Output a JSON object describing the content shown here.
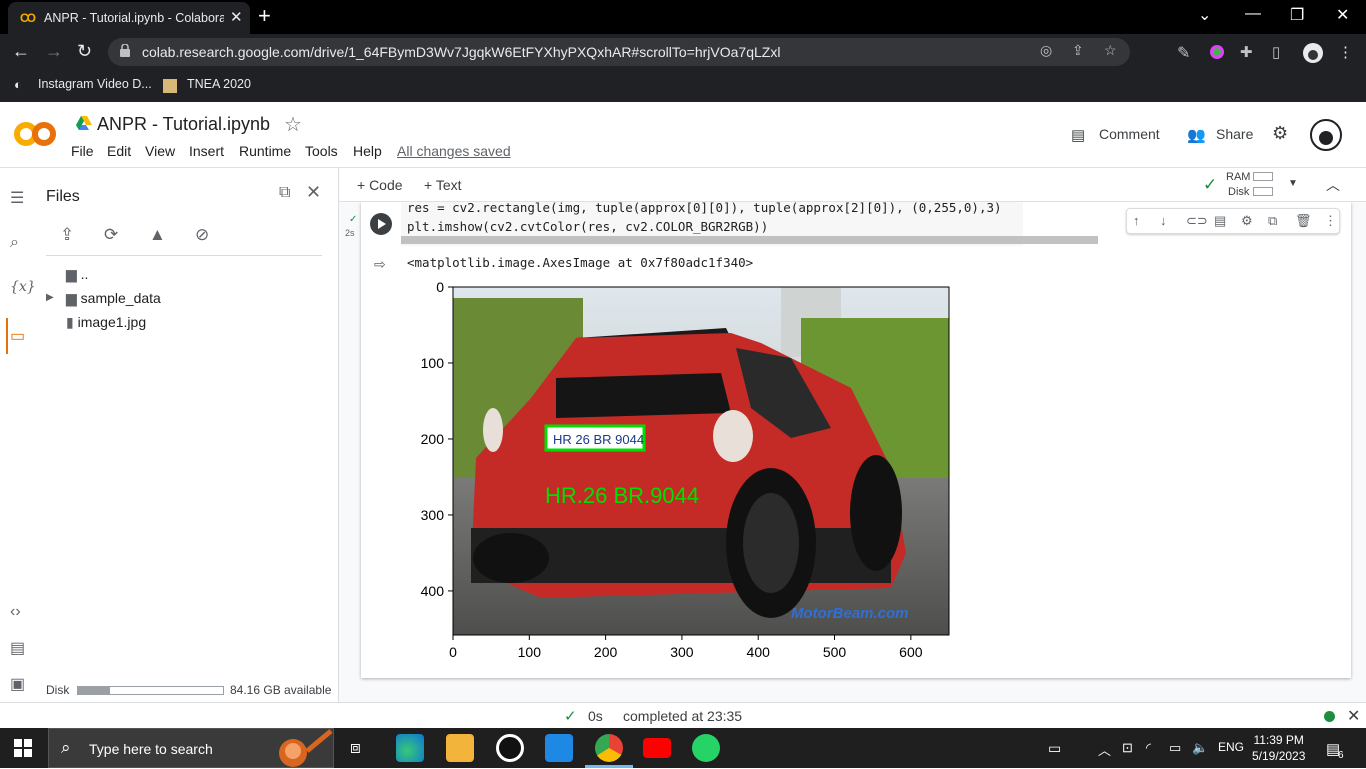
{
  "browser": {
    "tab_title": "ANPR - Tutorial.ipynb - Colabora",
    "url": "colab.research.google.com/drive/1_64FBymD3Wv7JgqkW6EtFYXhyPXQxhAR#scrollTo=hrjVOa7qLZxl",
    "bookmarks": [
      "Instagram Video D...",
      "TNEA 2020"
    ]
  },
  "colab": {
    "logo_text": "CO",
    "title": "ANPR - Tutorial.ipynb",
    "menu": [
      "File",
      "Edit",
      "View",
      "Insert",
      "Runtime",
      "Tools",
      "Help"
    ],
    "saved": "All changes saved",
    "comment": "Comment",
    "share": "Share"
  },
  "files": {
    "title": "Files",
    "parent": "..",
    "items": [
      "sample_data",
      "image1.jpg"
    ],
    "disk_label": "Disk",
    "disk_available": "84.16 GB available",
    "disk_used_fraction": 0.22
  },
  "toolbar": {
    "code": "+ Code",
    "text": "+ Text",
    "ram": "RAM",
    "disk": "Disk"
  },
  "cell": {
    "exec_time": "2s",
    "code_lines": [
      "res = cv2.rectangle(img, tuple(approx[0][0]), tuple(approx[2][0]), (0,255,0),3)",
      "plt.imshow(cv2.cvtColor(res, cv2.COLOR_BGR2RGB))"
    ],
    "output": "<matplotlib.image.AxesImage at 0x7f80adc1f340>"
  },
  "plot": {
    "yticks": [
      "0",
      "100",
      "200",
      "300",
      "400"
    ],
    "xticks": [
      "0",
      "100",
      "200",
      "300",
      "400",
      "500",
      "600"
    ],
    "plate": "HR 26 BR 9044",
    "overlay_text": "HR.26  BR.9044",
    "watermark": "MotorBeam.com",
    "accent": "#00e000"
  },
  "status": {
    "time": "0s",
    "message": "completed at 23:35"
  },
  "taskbar": {
    "search": "Type here to search",
    "lang": "ENG",
    "time": "11:39 PM",
    "date": "5/19/2023",
    "notif": "6"
  }
}
